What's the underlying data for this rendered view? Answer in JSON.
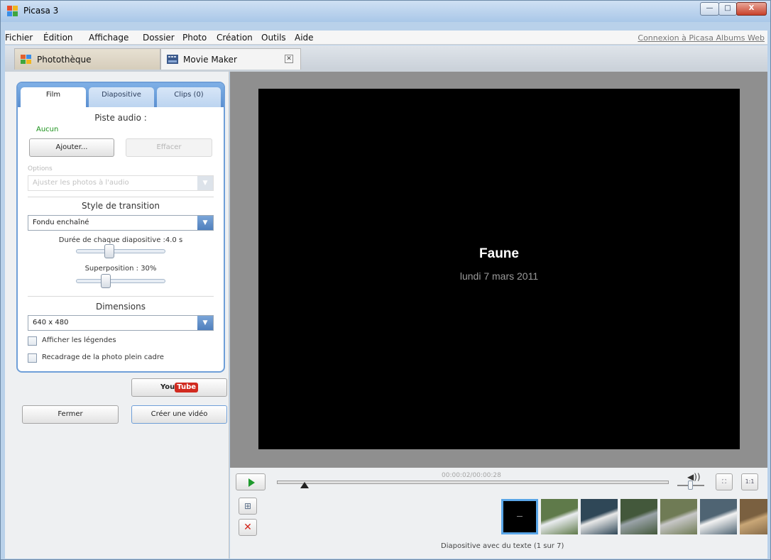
{
  "window": {
    "title": "Picasa 3",
    "controls": {
      "minimize": "—",
      "maximize": "□",
      "close": "X"
    }
  },
  "menu": {
    "items": [
      "Fichier",
      "Édition",
      "Affichage",
      "Dossier",
      "Photo",
      "Création",
      "Outils",
      "Aide"
    ],
    "web_link": "Connexion à Picasa Albums Web"
  },
  "tabs": {
    "library": "Photothèque",
    "movie_maker": "Movie Maker",
    "close_glyph": "✕"
  },
  "settings": {
    "tabs": {
      "film": "Film",
      "slide": "Diapositive",
      "clips": "Clips (0)"
    },
    "audio_heading": "Piste audio :",
    "audio_value": "Aucun",
    "add_button": "Ajouter...",
    "clear_button": "Effacer",
    "options_label": "Options",
    "options_value": "Ajuster les photos à l'audio",
    "transition_heading": "Style de transition",
    "transition_value": "Fondu enchaîné",
    "duration_label": "Durée de chaque diapositive :4.0 s",
    "duration_value": 0.35,
    "overlap_label": "Superposition : 30%",
    "overlap_value": 0.3,
    "dimensions_heading": "Dimensions",
    "dimensions_value": "640 x 480",
    "show_captions": "Afficher les légendes",
    "full_frame_crop": "Recadrage de la photo plein cadre",
    "youtube_you": "You",
    "youtube_tube": "Tube",
    "close_button": "Fermer",
    "create_video_button": "Créer une vidéo",
    "dropdown_arrow": "▼"
  },
  "preview": {
    "title": "Faune",
    "date": "lundi 7 mars 2011"
  },
  "controls": {
    "timecode": "00:00:02/00:00:28",
    "progress": 0.07,
    "volume_icon": "◀))",
    "full_screen_glyph": "⛶",
    "actual_size_label": "1:1",
    "add_text_glyph": "⊞",
    "delete_glyph": "✕",
    "status_text": "Diapositive avec du texte   (1 sur 7)"
  },
  "filmstrip": [
    {
      "kind": "text-slide",
      "colors": [
        "#000000"
      ]
    },
    {
      "kind": "stork",
      "colors": [
        "#5f7a4a",
        "#e9ecef"
      ]
    },
    {
      "kind": "swan",
      "colors": [
        "#2f4757",
        "#e8e8e8"
      ]
    },
    {
      "kind": "heron",
      "colors": [
        "#43583b",
        "#9aa3a8"
      ]
    },
    {
      "kind": "birds-grass",
      "colors": [
        "#6f7b55",
        "#c7c7c7"
      ]
    },
    {
      "kind": "egret",
      "colors": [
        "#4f6473",
        "#f2f2f2"
      ]
    },
    {
      "kind": "sandpiper",
      "colors": [
        "#7a6040",
        "#c9a777"
      ]
    }
  ]
}
